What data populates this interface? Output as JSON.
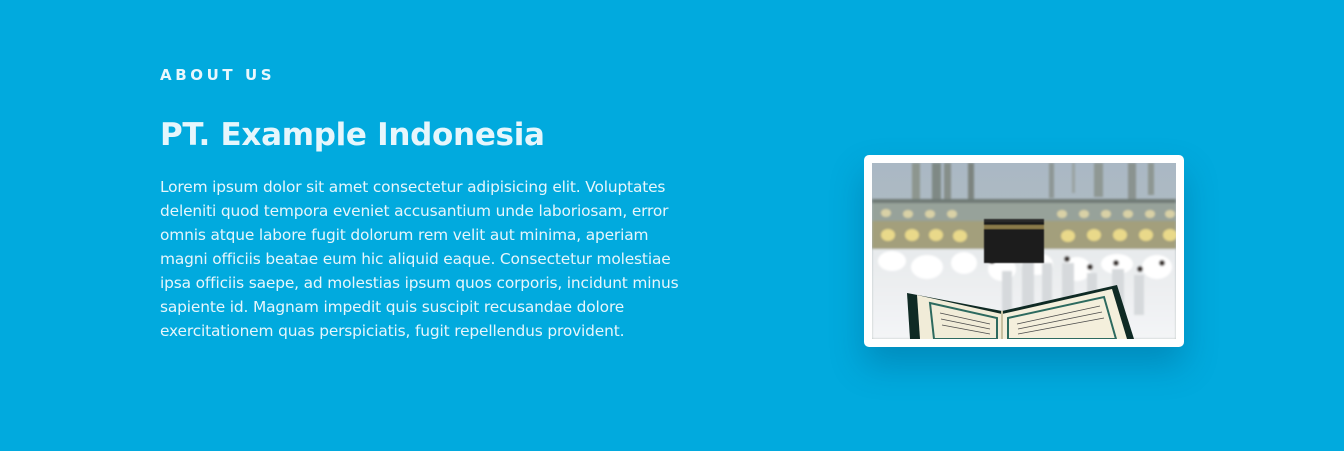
{
  "about": {
    "eyebrow": "ABOUT US",
    "title": "PT. Example Indonesia",
    "description": "Lorem ipsum dolor sit amet consectetur adipisicing elit. Voluptates deleniti quod tempora eveniet accusantium unde laboriosam, error omnis atque labore fugit dolorum rem velit aut minima, aperiam magni officiis beatae eum hic aliquid eaque. Consectetur molestiae ipsa officiis saepe, ad molestias ipsum quos corporis, incidunt minus sapiente id. Magnam impedit quis suscipit recusandae dolore exercitationem quas perspiciatis, fugit repellendus provident."
  },
  "image": {
    "subject": "kaaba-quran-photo"
  },
  "colors": {
    "background": "#01aade",
    "text": "#e6f6fc",
    "card": "#ffffff"
  }
}
